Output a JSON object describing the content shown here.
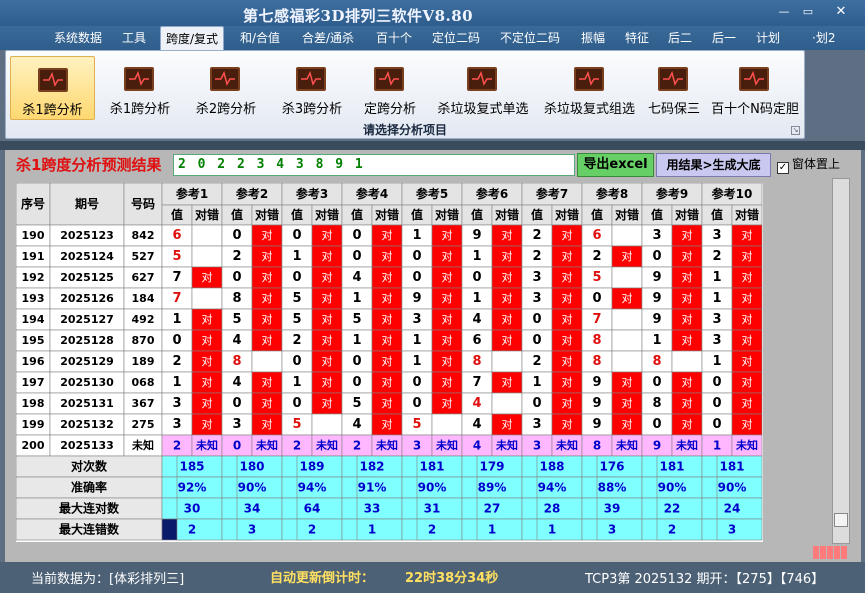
{
  "app": {
    "title": "第七感福彩3D排列三软件V8.80"
  },
  "window_controls": {
    "minimize": "—",
    "maximize": "▭",
    "close": "✕"
  },
  "menu": [
    "系统数据",
    "工具",
    "跨度/复式",
    "和/合值",
    "合差/通杀",
    "百十个",
    "定位二码",
    "不定位二码",
    "振幅",
    "特征",
    "后二",
    "后一",
    "计划",
    "·划2"
  ],
  "menu_active": 2,
  "ribbon": {
    "buttons": [
      "杀1跨分析",
      "杀1跨分析",
      "杀2跨分析",
      "杀3跨分析",
      "定跨分析",
      "杀垃圾复式单选",
      "杀垃圾复式组选",
      "七码保三",
      "百十个N码定胆"
    ],
    "caption": "请选择分析项目"
  },
  "result": {
    "title": "杀1跨度分析预测结果",
    "value": "2 0 2 2 3 4 3 8 9 1",
    "excel_button": "导出excel",
    "generate_button": "用结果>生成大底",
    "pin_label": "窗体置上",
    "pin_checked": true
  },
  "table": {
    "headers": {
      "seq": "序号",
      "issue": "期号",
      "number": "号码",
      "value": "值",
      "status": "对错"
    },
    "ref_names": [
      "参考1",
      "参考2",
      "参考3",
      "参考4",
      "参考5",
      "参考6",
      "参考7",
      "参考8",
      "参考9",
      "参考10"
    ],
    "rows": [
      {
        "seq": "190",
        "issue": "2025123",
        "num": "842",
        "refs": [
          [
            "6",
            "W"
          ],
          [
            "0",
            "R"
          ],
          [
            "0",
            "R"
          ],
          [
            "0",
            "R"
          ],
          [
            "1",
            "R"
          ],
          [
            "9",
            "R"
          ],
          [
            "2",
            "R"
          ],
          [
            "6",
            "W"
          ],
          [
            "3",
            "R"
          ],
          [
            "3",
            "R"
          ]
        ]
      },
      {
        "seq": "191",
        "issue": "2025124",
        "num": "527",
        "refs": [
          [
            "5",
            "W"
          ],
          [
            "2",
            "R"
          ],
          [
            "1",
            "R"
          ],
          [
            "0",
            "R"
          ],
          [
            "0",
            "R"
          ],
          [
            "1",
            "R"
          ],
          [
            "2",
            "R"
          ],
          [
            "2",
            "G"
          ],
          [
            "0",
            "R"
          ],
          [
            "2",
            "R"
          ]
        ]
      },
      {
        "seq": "192",
        "issue": "2025125",
        "num": "627",
        "refs": [
          [
            "7",
            "G"
          ],
          [
            "0",
            "R"
          ],
          [
            "0",
            "R"
          ],
          [
            "4",
            "R"
          ],
          [
            "0",
            "R"
          ],
          [
            "0",
            "R"
          ],
          [
            "3",
            "R"
          ],
          [
            "5",
            "W"
          ],
          [
            "9",
            "R"
          ],
          [
            "1",
            "R"
          ]
        ]
      },
      {
        "seq": "193",
        "issue": "2025126",
        "num": "184",
        "refs": [
          [
            "7",
            "W"
          ],
          [
            "8",
            "R"
          ],
          [
            "5",
            "R"
          ],
          [
            "1",
            "R"
          ],
          [
            "9",
            "R"
          ],
          [
            "1",
            "R"
          ],
          [
            "3",
            "R"
          ],
          [
            "0",
            "G"
          ],
          [
            "9",
            "R"
          ],
          [
            "1",
            "R"
          ]
        ]
      },
      {
        "seq": "194",
        "issue": "2025127",
        "num": "492",
        "refs": [
          [
            "1",
            "G"
          ],
          [
            "5",
            "R"
          ],
          [
            "5",
            "R"
          ],
          [
            "5",
            "R"
          ],
          [
            "3",
            "R"
          ],
          [
            "4",
            "R"
          ],
          [
            "0",
            "R"
          ],
          [
            "7",
            "W"
          ],
          [
            "9",
            "R"
          ],
          [
            "3",
            "R"
          ]
        ]
      },
      {
        "seq": "195",
        "issue": "2025128",
        "num": "870",
        "refs": [
          [
            "0",
            "G"
          ],
          [
            "4",
            "R"
          ],
          [
            "2",
            "R"
          ],
          [
            "1",
            "R"
          ],
          [
            "1",
            "R"
          ],
          [
            "6",
            "R"
          ],
          [
            "0",
            "R"
          ],
          [
            "8",
            "W"
          ],
          [
            "1",
            "R"
          ],
          [
            "3",
            "R"
          ]
        ]
      },
      {
        "seq": "196",
        "issue": "2025129",
        "num": "189",
        "refs": [
          [
            "2",
            "G"
          ],
          [
            "8",
            "W"
          ],
          [
            "0",
            "R"
          ],
          [
            "0",
            "R"
          ],
          [
            "1",
            "R"
          ],
          [
            "8",
            "W"
          ],
          [
            "2",
            "R"
          ],
          [
            "8",
            "W"
          ],
          [
            "8",
            "W"
          ],
          [
            "1",
            "R"
          ]
        ]
      },
      {
        "seq": "197",
        "issue": "2025130",
        "num": "068",
        "refs": [
          [
            "1",
            "G"
          ],
          [
            "4",
            "R"
          ],
          [
            "1",
            "R"
          ],
          [
            "0",
            "R"
          ],
          [
            "0",
            "R"
          ],
          [
            "7",
            "R"
          ],
          [
            "1",
            "R"
          ],
          [
            "9",
            "R"
          ],
          [
            "0",
            "R"
          ],
          [
            "0",
            "R"
          ]
        ]
      },
      {
        "seq": "198",
        "issue": "2025131",
        "num": "367",
        "refs": [
          [
            "3",
            "G"
          ],
          [
            "0",
            "R"
          ],
          [
            "0",
            "G"
          ],
          [
            "5",
            "R"
          ],
          [
            "0",
            "R"
          ],
          [
            "4",
            "W"
          ],
          [
            "0",
            "R"
          ],
          [
            "9",
            "R"
          ],
          [
            "8",
            "R"
          ],
          [
            "0",
            "R"
          ]
        ]
      },
      {
        "seq": "199",
        "issue": "2025132",
        "num": "275",
        "refs": [
          [
            "3",
            "G"
          ],
          [
            "3",
            "R"
          ],
          [
            "5",
            "W"
          ],
          [
            "4",
            "R"
          ],
          [
            "5",
            "W"
          ],
          [
            "4",
            "R"
          ],
          [
            "3",
            "R"
          ],
          [
            "9",
            "R"
          ],
          [
            "0",
            "R"
          ],
          [
            "0",
            "R"
          ]
        ]
      },
      {
        "seq": "200",
        "issue": "2025133",
        "num": "未知",
        "refs": [
          [
            "2",
            "U"
          ],
          [
            "0",
            "U"
          ],
          [
            "2",
            "U"
          ],
          [
            "2",
            "U"
          ],
          [
            "3",
            "U"
          ],
          [
            "4",
            "U"
          ],
          [
            "3",
            "U"
          ],
          [
            "8",
            "U"
          ],
          [
            "9",
            "U"
          ],
          [
            "1",
            "U"
          ]
        ]
      }
    ],
    "unknown_label": "未知",
    "correct_label": "对",
    "stats": [
      {
        "label": "对次数",
        "values": [
          "185",
          "180",
          "189",
          "182",
          "181",
          "179",
          "188",
          "176",
          "181",
          "181"
        ]
      },
      {
        "label": "准确率",
        "values": [
          "92%",
          "90%",
          "94%",
          "91%",
          "90%",
          "89%",
          "94%",
          "88%",
          "90%",
          "90%"
        ]
      },
      {
        "label": "最大连对数",
        "values": [
          "30",
          "34",
          "64",
          "33",
          "31",
          "27",
          "28",
          "39",
          "22",
          "24"
        ]
      },
      {
        "label": "最大连错数",
        "values": [
          "2",
          "3",
          "2",
          "1",
          "2",
          "1",
          "1",
          "3",
          "2",
          "3"
        ]
      }
    ]
  },
  "colors": {
    "wrong": "#e01010",
    "correct_bg": "#ff0000",
    "unknown_bg": "#ffb8ff",
    "stats_bg": "#7fffff",
    "win_green": "#00c000"
  },
  "status": {
    "current_data_label": "当前数据为：[体彩排列三]",
    "countdown_label": "自动更新倒计时：",
    "countdown_value": "22时38分34秒",
    "latest": "TCP3第 2025132 期开：【275】【746】"
  }
}
